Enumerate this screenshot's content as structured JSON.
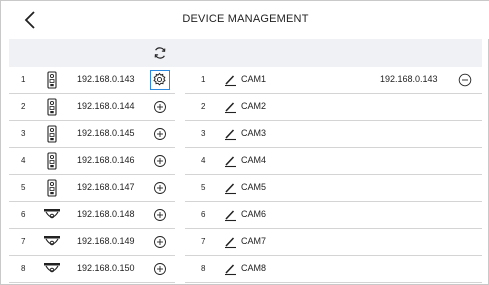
{
  "header": {
    "title": "DEVICE MANAGEMENT",
    "back_icon": "chevron-left-icon"
  },
  "toolbar": {
    "refresh_icon": "refresh-icon"
  },
  "devices": [
    {
      "num": "1",
      "ip": "192.168.0.143",
      "type": "door-station-icon",
      "action": "settings-icon"
    },
    {
      "num": "2",
      "ip": "192.168.0.144",
      "type": "door-station-icon",
      "action": "add-icon"
    },
    {
      "num": "3",
      "ip": "192.168.0.145",
      "type": "door-station-icon",
      "action": "add-icon"
    },
    {
      "num": "4",
      "ip": "192.168.0.146",
      "type": "door-station-icon",
      "action": "add-icon"
    },
    {
      "num": "5",
      "ip": "192.168.0.147",
      "type": "door-station-icon",
      "action": "add-icon"
    },
    {
      "num": "6",
      "ip": "192.168.0.148",
      "type": "dome-camera-icon",
      "action": "add-icon"
    },
    {
      "num": "7",
      "ip": "192.168.0.149",
      "type": "dome-camera-icon",
      "action": "add-icon"
    },
    {
      "num": "8",
      "ip": "192.168.0.150",
      "type": "dome-camera-icon",
      "action": "add-icon"
    }
  ],
  "cameras": [
    {
      "num": "1",
      "name": "CAM1",
      "ip": "192.168.0.143",
      "removable": true
    },
    {
      "num": "2",
      "name": "CAM2",
      "ip": "",
      "removable": false
    },
    {
      "num": "3",
      "name": "CAM3",
      "ip": "",
      "removable": false
    },
    {
      "num": "4",
      "name": "CAM4",
      "ip": "",
      "removable": false
    },
    {
      "num": "5",
      "name": "CAM5",
      "ip": "",
      "removable": false
    },
    {
      "num": "6",
      "name": "CAM6",
      "ip": "",
      "removable": false
    },
    {
      "num": "7",
      "name": "CAM7",
      "ip": "",
      "removable": false
    },
    {
      "num": "8",
      "name": "CAM8",
      "ip": "",
      "removable": false
    }
  ],
  "colors": {
    "selected_border": "#2b8ae0",
    "toolbar_bg": "#f0f1f5",
    "divider": "#d4d4d4"
  }
}
